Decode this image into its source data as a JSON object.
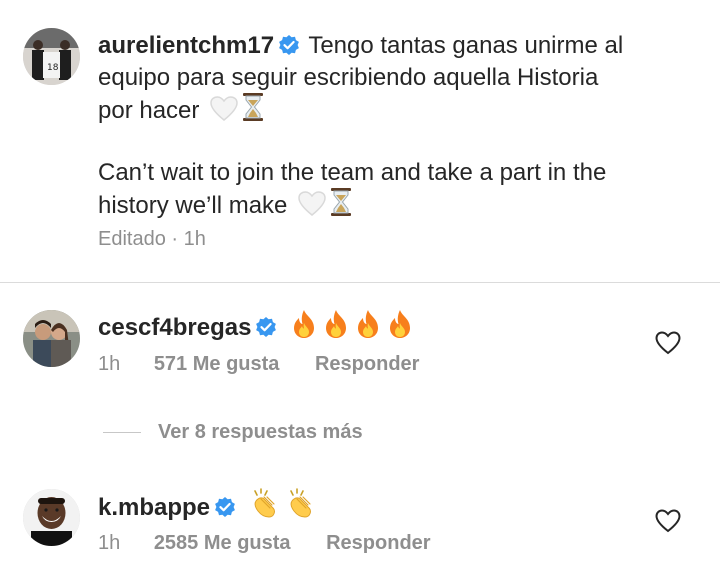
{
  "caption": {
    "username": "aurelientchm17",
    "line1": "Tengo tantas ganas unirme al",
    "line2": "equipo para seguir escribiendo aquella Historia",
    "line3": "por hacer",
    "line4": "Can’t wait to join the team and take a part in the",
    "line5": "history we’ll make",
    "meta": "Editado · 1h",
    "emojis": [
      "white-heart-icon",
      "hourglass-icon"
    ]
  },
  "comments": [
    {
      "username": "cescf4bregas",
      "emojis": [
        "fire-icon",
        "fire-icon",
        "fire-icon",
        "fire-icon"
      ],
      "time": "1h",
      "likes": "571 Me gusta",
      "reply": "Responder"
    },
    {
      "username": "k.mbappe",
      "emojis": [
        "clapping-hands-icon",
        "clapping-hands-icon"
      ],
      "time": "1h",
      "likes": "2585 Me gusta",
      "reply": "Responder"
    }
  ],
  "view_replies": "Ver 8 respuestas más",
  "colors": {
    "text": "#262626",
    "muted": "#8e8e8e",
    "verified_blue": "#3897f0",
    "divider": "#dbdbdb"
  }
}
